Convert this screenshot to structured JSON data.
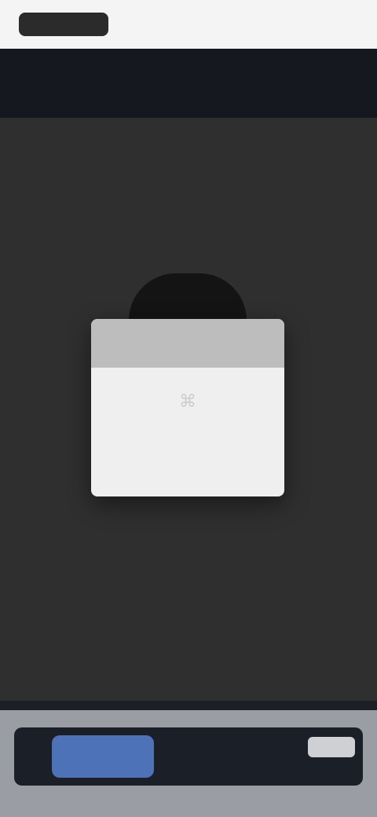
{
  "status_bar": {
    "left_text": "",
    "right_text": ""
  },
  "main": {
    "heading": "",
    "subheading": ""
  },
  "card": {
    "glyph": "⌘",
    "caption": ""
  },
  "bottom_bar": {
    "primary_label": "",
    "secondary_label": "",
    "chip_label": ""
  },
  "colors": {
    "status_bar_bg": "#f4f4f4",
    "header_bg": "#15181e",
    "main_bg": "#2f2f2f",
    "card_bg": "#efefef",
    "card_top_bg": "#bdbdbd",
    "bottom_bg": "#9a9da3",
    "bottom_panel_bg": "#1b1f28",
    "primary_button_bg": "#4d72b8"
  }
}
